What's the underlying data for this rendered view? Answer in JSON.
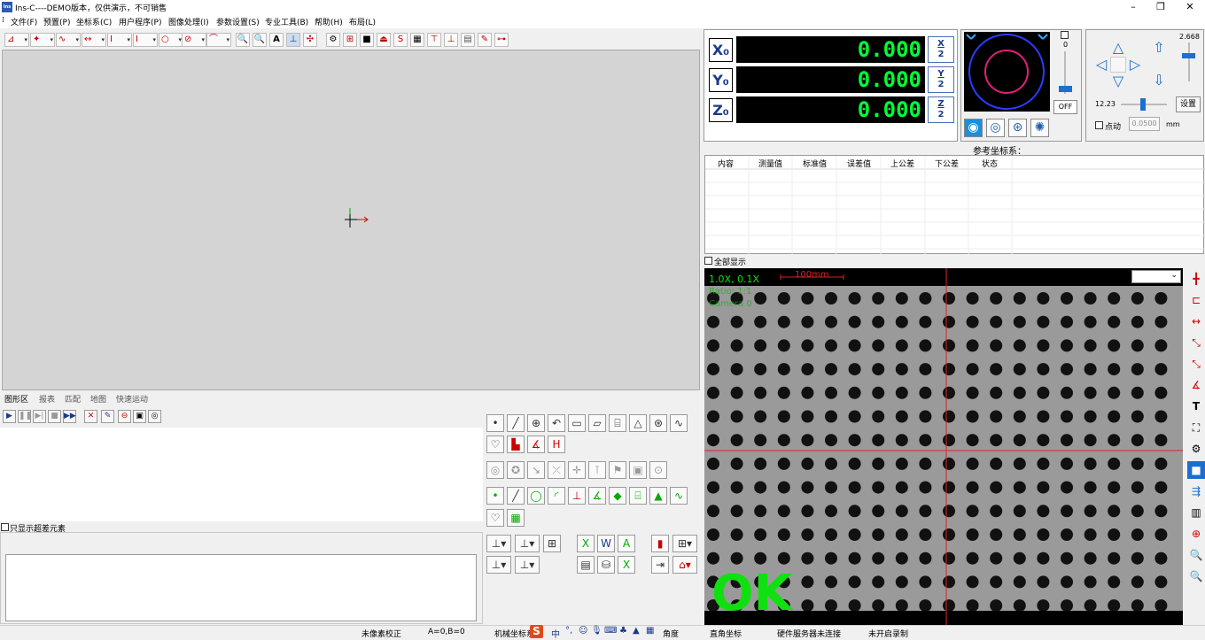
{
  "window": {
    "title": "Ins-C----DEMO版本，仅供演示，不可销售",
    "app_icon": "Ins"
  },
  "menu": [
    {
      "label": "文件(F)"
    },
    {
      "label": "预置(P)"
    },
    {
      "label": "坐标系(C)"
    },
    {
      "label": "用户程序(P)"
    },
    {
      "label": "图像处理(I)"
    },
    {
      "label": "参数设置(S)"
    },
    {
      "label": "专业工具(B)"
    },
    {
      "label": "帮助(H)"
    },
    {
      "label": "布局(L)"
    }
  ],
  "tabs": [
    {
      "label": "图形区"
    },
    {
      "label": "报表"
    },
    {
      "label": "匹配"
    },
    {
      "label": "地图"
    },
    {
      "label": "快速运动"
    }
  ],
  "dro": {
    "x_label": "X₀",
    "y_label": "Y₀",
    "z_label": "Z₀",
    "x_value": "0.000",
    "y_value": "0.000",
    "z_value": "0.000",
    "x_half_top": "X",
    "y_half_top": "Y",
    "z_half_top": "Z",
    "half_bottom": "2"
  },
  "light": {
    "slider_value": "0",
    "off_label": "OFF"
  },
  "motion": {
    "speed_value": "2.668",
    "step_value": "12.23",
    "set_label": "设置",
    "jog_label": "点动",
    "jog_amount": "0.0500",
    "unit": "mm"
  },
  "table": {
    "ref_title": "参考坐标系：",
    "headers": [
      "内容",
      "测量值",
      "标准值",
      "误差值",
      "上公差",
      "下公差",
      "状态"
    ],
    "show_all_label": "全部显示"
  },
  "camera": {
    "zoom_text": "1.0X, 0.1X",
    "scale_text": "100mm",
    "ratio_text": "Ratio: 1:1",
    "camera_text": "Camera 0",
    "result": "OK",
    "result_color": "#10e010"
  },
  "bottom": {
    "only_over_label": "只显示超差元素"
  },
  "status": {
    "pixel_calib": "未像素校正",
    "ab": "A=0,B=0",
    "coord_sys": "机械坐标系",
    "ime": "中",
    "angle": "角度",
    "rect": "直角坐标",
    "hardware": "硬件服务器未连接",
    "record": "未开启录制"
  },
  "colors": {
    "accent": "#1a3a8a",
    "dro_digits": "#00ff33"
  }
}
